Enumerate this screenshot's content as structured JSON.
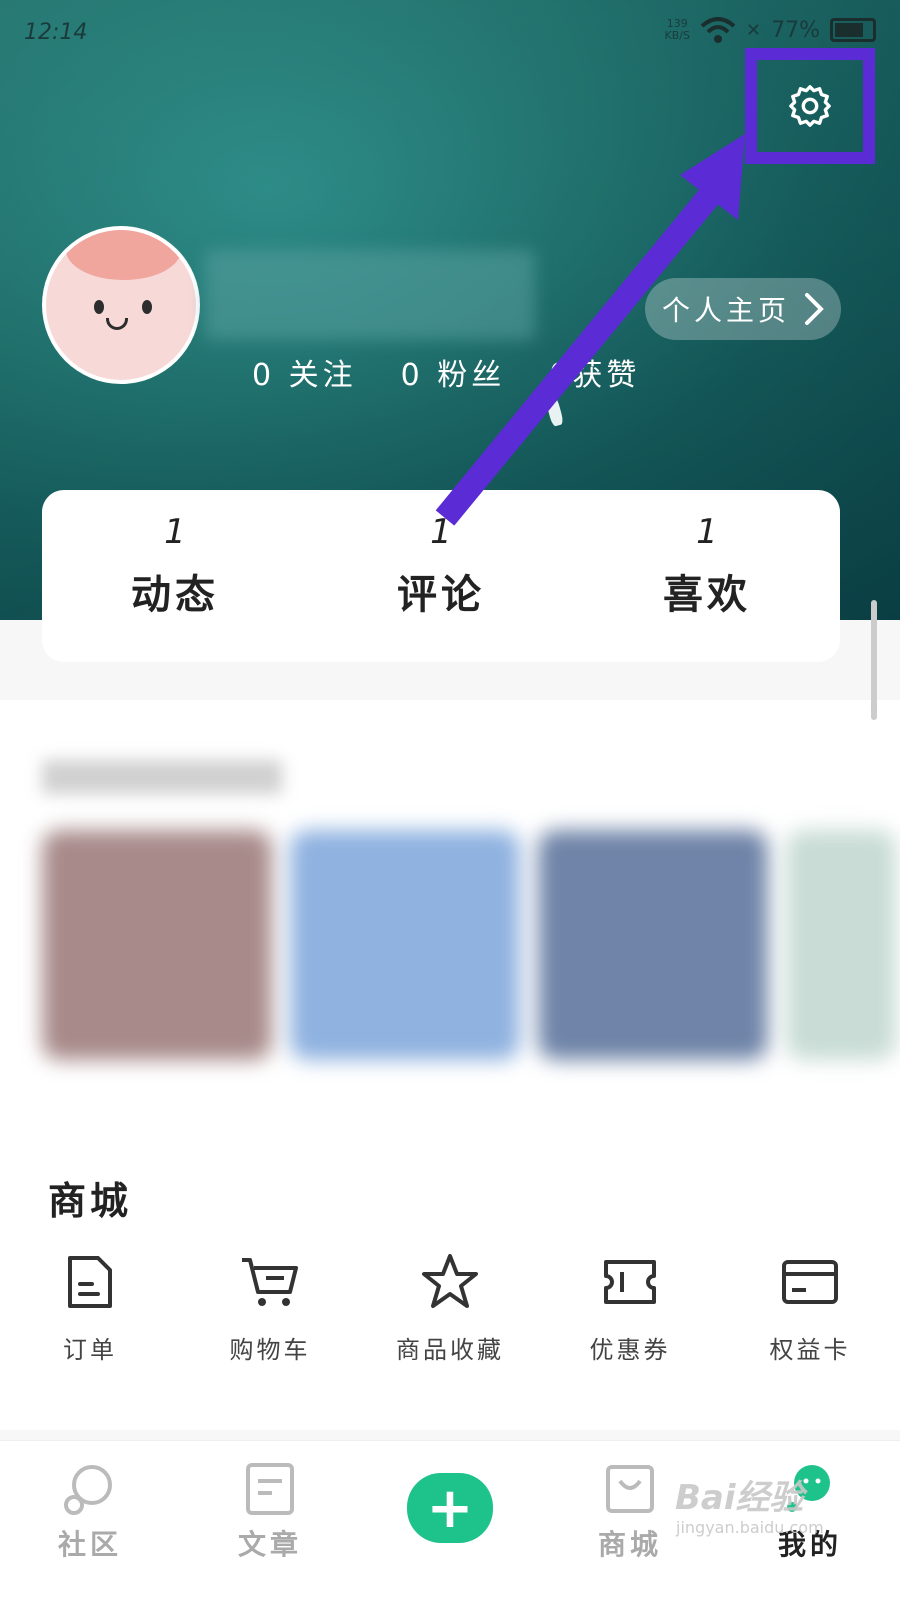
{
  "status": {
    "time": "12:14",
    "speed_value": "139",
    "speed_unit": "KB/S",
    "battery": "77%"
  },
  "profile": {
    "homepage_label": "个人主页",
    "stats": [
      {
        "count": "0",
        "label": "关注"
      },
      {
        "count": "0",
        "label": "粉丝"
      },
      {
        "count": "0",
        "label": "获赞"
      }
    ]
  },
  "activity": [
    {
      "count": "1",
      "label": "动态"
    },
    {
      "count": "1",
      "label": "评论"
    },
    {
      "count": "1",
      "label": "喜欢"
    }
  ],
  "mall": {
    "title": "商城",
    "items": [
      {
        "label": "订单",
        "icon": "order-icon"
      },
      {
        "label": "购物车",
        "icon": "cart-icon"
      },
      {
        "label": "商品收藏",
        "icon": "star-icon"
      },
      {
        "label": "优惠券",
        "icon": "ticket-icon"
      },
      {
        "label": "权益卡",
        "icon": "card-icon"
      }
    ]
  },
  "tabs": [
    {
      "label": "社区",
      "icon": "community-icon"
    },
    {
      "label": "文章",
      "icon": "article-icon"
    },
    {
      "label": "",
      "icon": "plus-icon"
    },
    {
      "label": "商城",
      "icon": "bag-icon"
    },
    {
      "label": "我的",
      "icon": "me-icon"
    }
  ],
  "watermark": {
    "main": "Bai经验",
    "sub": "jingyan.baidu.com"
  },
  "colors": {
    "accent": "#1ec28b",
    "highlight": "#5b2bd6"
  }
}
